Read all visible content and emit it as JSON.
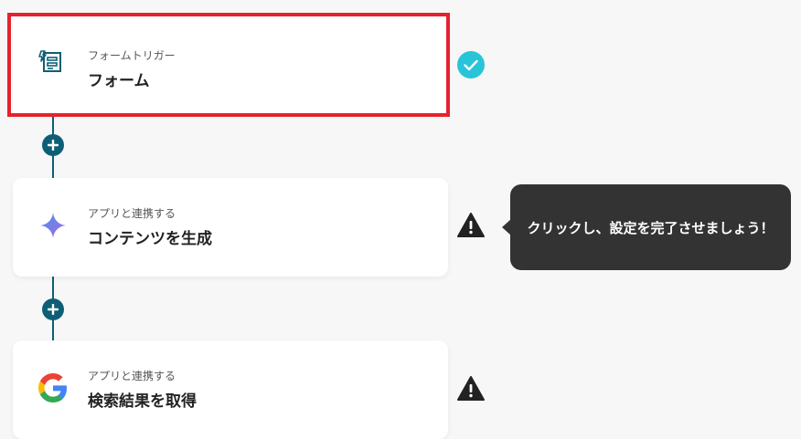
{
  "steps": [
    {
      "subtitle": "フォームトリガー",
      "title": "フォーム",
      "icon": "form-icon",
      "status": "check-circle-icon"
    },
    {
      "subtitle": "アプリと連携する",
      "title": "コンテンツを生成",
      "icon": "gemini-sparkle-icon",
      "status": "warning-icon"
    },
    {
      "subtitle": "アプリと連携する",
      "title": "検索結果を取得",
      "icon": "google-icon",
      "status": "warning-icon"
    }
  ],
  "tooltip": {
    "text": "クリックし、設定を完了させましょう！"
  },
  "colors": {
    "accent": "#0e5f76",
    "highlight": "#e6222d",
    "check": "#28c4d8",
    "tooltip_bg": "#333333"
  }
}
